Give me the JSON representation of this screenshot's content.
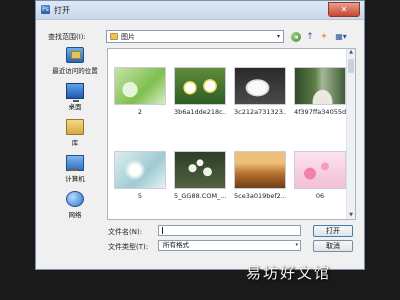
{
  "window": {
    "title": "打开",
    "close_glyph": "✕"
  },
  "lookin": {
    "label": "查找范围(I):",
    "value": "图片",
    "arrow": "▾"
  },
  "toolbar": {
    "back": "◂",
    "up": "↑",
    "newfolder": "✦",
    "views": "▦▾"
  },
  "places": [
    {
      "label": "最近访问的位置",
      "icon": "recent-places-icon"
    },
    {
      "label": "桌面",
      "icon": "desktop-icon"
    },
    {
      "label": "库",
      "icon": "library-icon"
    },
    {
      "label": "计算机",
      "icon": "computer-icon"
    },
    {
      "label": "网络",
      "icon": "network-icon"
    }
  ],
  "files": [
    {
      "caption": "2"
    },
    {
      "caption": "3b6a1dde218c..."
    },
    {
      "caption": "3c212a731323..."
    },
    {
      "caption": "4f397ffa34055d..."
    },
    {
      "caption": "5"
    },
    {
      "caption": "5_GG88.COM_..."
    },
    {
      "caption": "5ce3a019bef2..."
    },
    {
      "caption": "06"
    }
  ],
  "filename": {
    "label": "文件名(N):",
    "value": ""
  },
  "filetype": {
    "label": "文件类型(T):",
    "value": "所有格式",
    "arrow": "▾"
  },
  "buttons": {
    "open": "打开",
    "cancel": "取消"
  },
  "watermark": "易坊好文馆"
}
